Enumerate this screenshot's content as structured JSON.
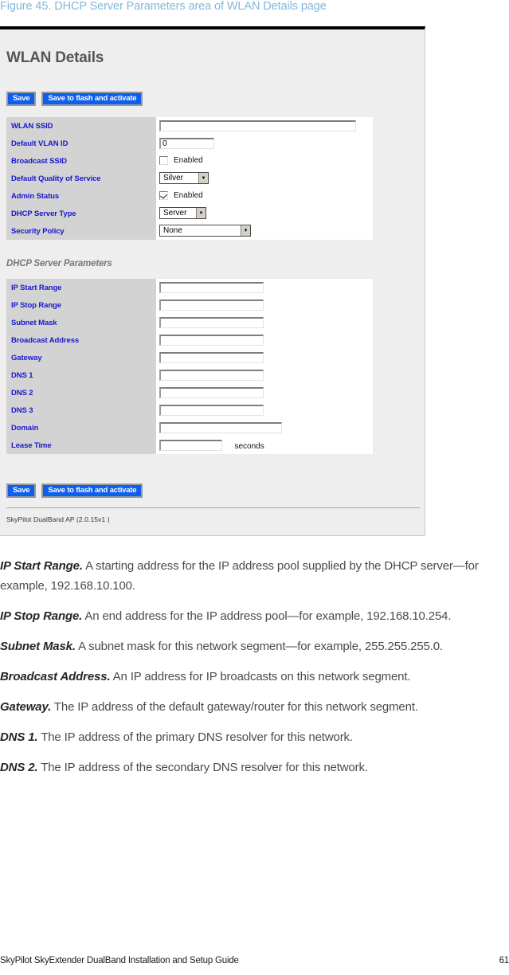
{
  "figure": {
    "caption": "Figure 45. DHCP Server Parameters area of WLAN Details page"
  },
  "screenshot": {
    "page_title": "WLAN Details",
    "buttons": {
      "save": "Save",
      "save_flash": "Save to flash and activate"
    },
    "section_heading": "DHCP Server Parameters",
    "version_text": "SkyPilot DualBand AP (2.0.15v1 )",
    "colors": {
      "label_cell_bg": "#d3d3d3",
      "label_text": "#1717d0",
      "button_bg": "#0d5ff0",
      "panel_bg": "#eeeeee",
      "heading_text": "#555555"
    },
    "wlan_fields": [
      {
        "label": "WLAN SSID",
        "type": "text",
        "value": ""
      },
      {
        "label": "Default VLAN ID",
        "type": "text",
        "value": "0"
      },
      {
        "label": "Broadcast SSID",
        "type": "checkbox",
        "checked": false,
        "cb_label": "Enabled"
      },
      {
        "label": "Default Quality of Service",
        "type": "select",
        "value": "Silver"
      },
      {
        "label": "Admin Status",
        "type": "checkbox",
        "checked": true,
        "cb_label": "Enabled"
      },
      {
        "label": "DHCP Server Type",
        "type": "select",
        "value": "Server"
      },
      {
        "label": "Security Policy",
        "type": "select",
        "value": "None"
      }
    ],
    "dhcp_fields": [
      {
        "label": "IP Start Range",
        "value": ""
      },
      {
        "label": "IP Stop Range",
        "value": ""
      },
      {
        "label": "Subnet Mask",
        "value": ""
      },
      {
        "label": "Broadcast Address",
        "value": ""
      },
      {
        "label": "Gateway",
        "value": ""
      },
      {
        "label": "DNS 1",
        "value": ""
      },
      {
        "label": "DNS 2",
        "value": ""
      },
      {
        "label": "DNS 3",
        "value": ""
      },
      {
        "label": "Domain",
        "value": ""
      },
      {
        "label": "Lease Time",
        "value": "",
        "unit": "seconds"
      }
    ]
  },
  "descriptions": [
    {
      "term": "IP Start Range.",
      "text": " A starting address for the IP address pool supplied by the DHCP server—for example, 192.168.10.100."
    },
    {
      "term": "IP Stop Range.",
      "text": " An end address for the IP address pool—for example, 192.168.10.254."
    },
    {
      "term": "Subnet Mask.",
      "text": " A subnet mask for this network segment—for example, 255.255.255.0."
    },
    {
      "term": "Broadcast Address.",
      "text": " An IP address for IP broadcasts on this network segment."
    },
    {
      "term": "Gateway.",
      "text": " The IP address of the default gateway/router for this network segment."
    },
    {
      "term": "DNS 1.",
      "text": " The IP address of the primary DNS resolver for this network."
    },
    {
      "term": "DNS 2.",
      "text": " The IP address of the secondary DNS resolver for this network."
    }
  ],
  "page_footer": {
    "title": "SkyPilot SkyExtender DualBand Installation and Setup Guide",
    "page_number": "61"
  }
}
